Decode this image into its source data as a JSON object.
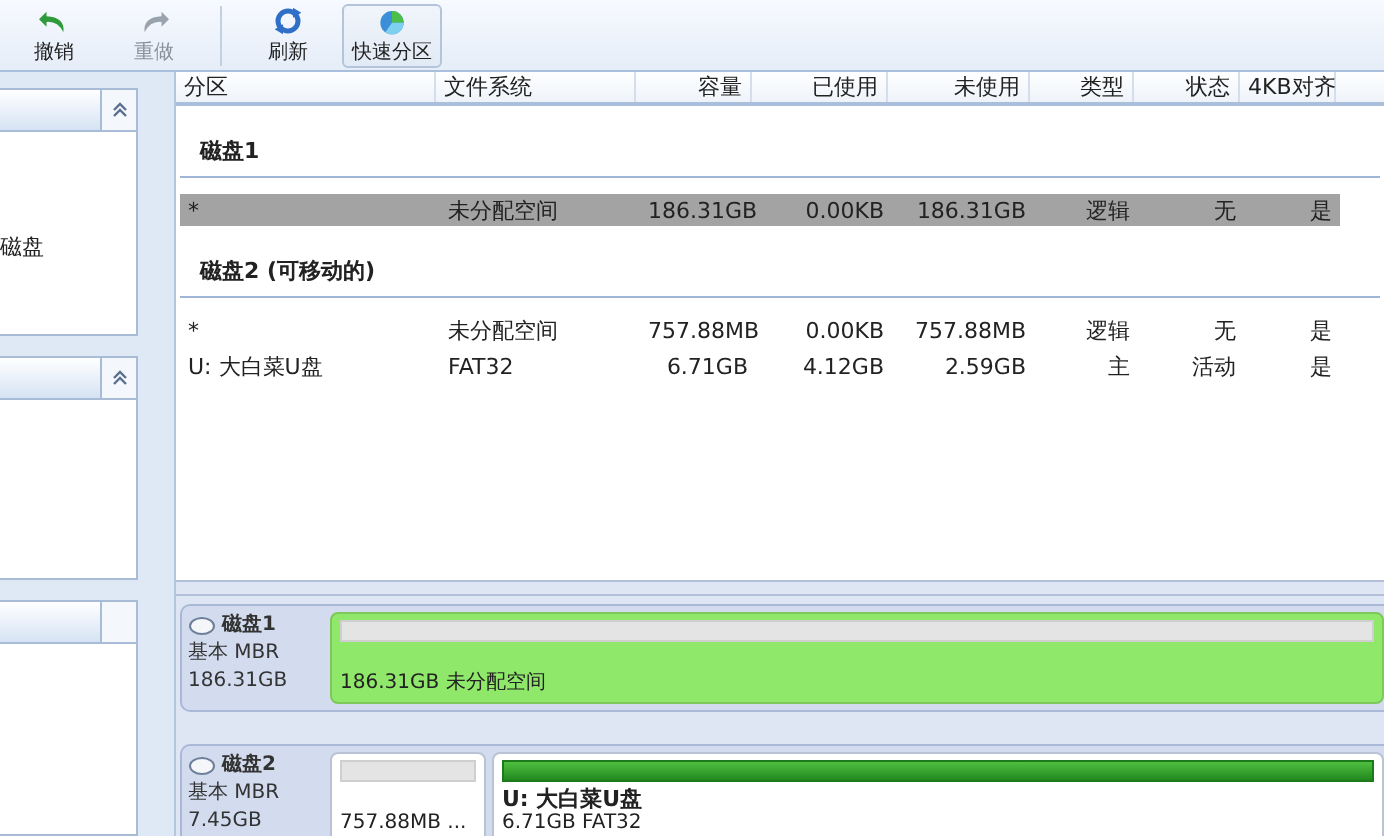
{
  "toolbar": {
    "buttons": [
      {
        "label": "撤销",
        "kind": "undo",
        "disabled": false,
        "selected": false
      },
      {
        "label": "重做",
        "kind": "redo",
        "disabled": true,
        "selected": false
      },
      {
        "label": "刷新",
        "kind": "refresh",
        "disabled": false,
        "selected": false
      },
      {
        "label": "快速分区",
        "kind": "quick",
        "disabled": false,
        "selected": true
      }
    ]
  },
  "sidebar": {
    "panels": [
      {
        "collapse_button": true,
        "items": [
          "磁盘"
        ]
      },
      {
        "collapse_button": true
      },
      {
        "collapse_button": false
      }
    ]
  },
  "table": {
    "columns": [
      "分区",
      "文件系统",
      "容量",
      "已使用",
      "未使用",
      "类型",
      "状态",
      "4KB对齐"
    ],
    "groups": [
      {
        "title": "磁盘1",
        "rows": [
          {
            "cells": [
              "*",
              "未分配空间",
              "186.31GB",
              "0.00KB",
              "186.31GB",
              "逻辑",
              "无",
              "是"
            ],
            "selected": true
          }
        ]
      },
      {
        "title": "磁盘2 (可移动的)",
        "rows": [
          {
            "cells": [
              "*",
              "未分配空间",
              "757.88MB",
              "0.00KB",
              "757.88MB",
              "逻辑",
              "无",
              "是"
            ],
            "selected": false
          },
          {
            "cells": [
              "U: 大白菜U盘",
              "FAT32",
              "6.71GB",
              "4.12GB",
              "2.59GB",
              "主",
              "活动",
              "是"
            ],
            "selected": false
          }
        ]
      }
    ]
  },
  "disk_map": {
    "disks": [
      {
        "name": "磁盘1",
        "type": "基本 MBR",
        "size": "186.31GB",
        "partitions": [
          {
            "kind": "unallocated",
            "selected": true,
            "detail": "186.31GB 未分配空间"
          }
        ]
      },
      {
        "name": "磁盘2",
        "type": "基本 MBR",
        "size": "7.45GB",
        "partitions": [
          {
            "kind": "unallocated",
            "selected": false,
            "detail": "757.88MB ..."
          },
          {
            "kind": "fat32",
            "selected": false,
            "title": "U: 大白菜U盘",
            "detail": "6.71GB FAT32"
          }
        ]
      }
    ]
  }
}
